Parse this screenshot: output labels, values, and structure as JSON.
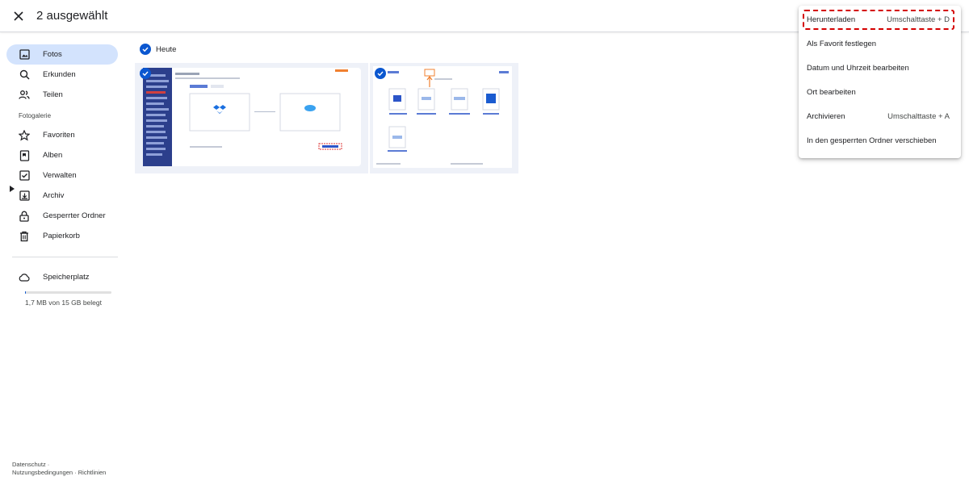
{
  "topbar": {
    "selected_count_label": "2 ausgewählt"
  },
  "sidebar": {
    "items": [
      {
        "label": "Fotos",
        "icon": "photo-icon",
        "active": true
      },
      {
        "label": "Erkunden",
        "icon": "search-icon"
      },
      {
        "label": "Teilen",
        "icon": "people-icon"
      }
    ],
    "section_label": "Fotogalerie",
    "library_items": [
      {
        "label": "Favoriten",
        "icon": "star-icon"
      },
      {
        "label": "Alben",
        "icon": "album-icon"
      },
      {
        "label": "Verwalten",
        "icon": "checklist-icon"
      },
      {
        "label": "Archiv",
        "icon": "archive-icon"
      },
      {
        "label": "Gesperrter Ordner",
        "icon": "lock-icon"
      },
      {
        "label": "Papierkorb",
        "icon": "trash-icon"
      }
    ],
    "storage": {
      "label": "Speicherplatz",
      "icon": "cloud-icon",
      "usage_text": "1,7 MB von 15 GB belegt",
      "fraction_used": 0.0001
    },
    "footer": {
      "privacy": "Datenschutz",
      "separator": "·",
      "terms": "Nutzungsbedingungen",
      "guidelines": "Richtlinien"
    }
  },
  "main": {
    "date_group_label": "Heute"
  },
  "context_menu": {
    "items": [
      {
        "label": "Herunterladen",
        "shortcut": "Umschalttaste + D"
      },
      {
        "label": "Als Favorit festlegen",
        "shortcut": ""
      },
      {
        "label": "Datum und Uhrzeit bearbeiten",
        "shortcut": ""
      },
      {
        "label": "Ort bearbeiten",
        "shortcut": ""
      },
      {
        "label": "Archivieren",
        "shortcut": "Umschalttaste + A"
      },
      {
        "label": "In den gesperrten Ordner verschieben",
        "shortcut": ""
      }
    ]
  },
  "colors": {
    "accent": "#0b57d0",
    "active_nav_bg": "#d3e3fd",
    "highlight": "#d40000"
  }
}
